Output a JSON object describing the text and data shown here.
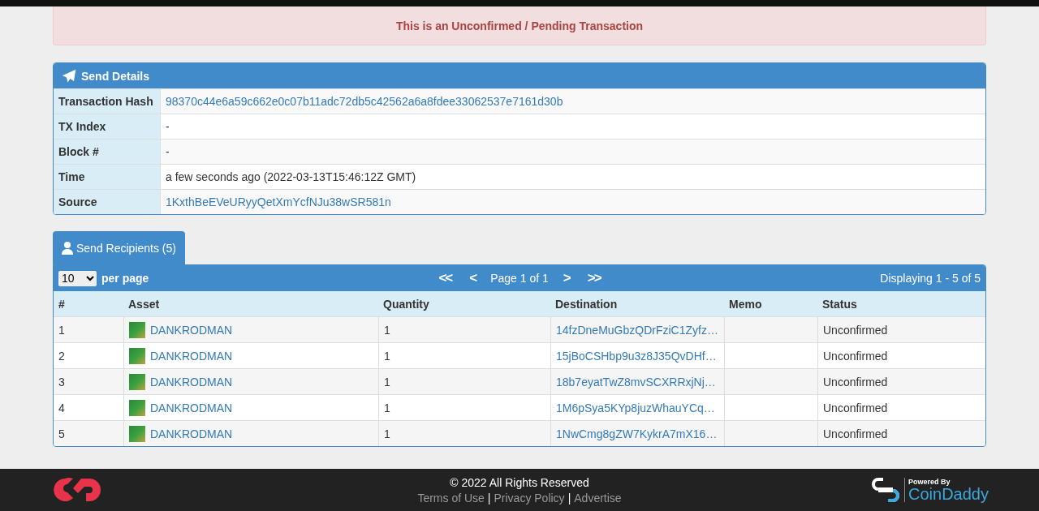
{
  "alert": {
    "text": "This is an Unconfirmed / Pending Transaction"
  },
  "send_details": {
    "title": "Send Details",
    "rows": [
      {
        "label": "Transaction Hash",
        "value": "98370c44e6a59c662e0c07b11adc72db5c42562a6a8fdee33062537e7161d30b",
        "kind": "link"
      },
      {
        "label": "TX Index",
        "value": "-",
        "kind": "text"
      },
      {
        "label": "Block #",
        "value": "-",
        "kind": "text"
      },
      {
        "label": "Time",
        "value": "a few seconds ago (2022-03-13T15:46:12Z GMT)",
        "kind": "text"
      },
      {
        "label": "Source",
        "value": "1KxthBeEVeURyyQetXmYcfNJu38wSR581n",
        "kind": "link"
      }
    ]
  },
  "tabs": [
    {
      "label": "Send Recipients (5)",
      "selected": true
    }
  ],
  "pager": {
    "page_size": "10",
    "per_page": "per page",
    "first": "<<",
    "prev": "<",
    "page": "Page 1 of 1",
    "next": ">",
    "last": ">>",
    "displaying": "Displaying 1 - 5 of 5"
  },
  "table": {
    "columns": [
      "#",
      "Asset",
      "Quantity",
      "Destination",
      "Memo",
      "Status"
    ],
    "rows": [
      {
        "index": "1",
        "asset": "DANKRODMAN",
        "quantity": "1",
        "destination": "14fzDneMuGbzQDrFziC1Zyfz…",
        "status": "Unconfirmed"
      },
      {
        "index": "2",
        "asset": "DANKRODMAN",
        "quantity": "1",
        "destination": "15jBoCSHbp9u3z8J35QvDHf…",
        "status": "Unconfirmed"
      },
      {
        "index": "3",
        "asset": "DANKRODMAN",
        "quantity": "1",
        "destination": "18b7eyatTwZ8mvSCXRRxjNj…",
        "status": "Unconfirmed"
      },
      {
        "index": "4",
        "asset": "DANKRODMAN",
        "quantity": "1",
        "destination": "1M6pSya5KYp8juzWhauYCq…",
        "status": "Unconfirmed"
      },
      {
        "index": "5",
        "asset": "DANKRODMAN",
        "quantity": "1",
        "destination": "1NwCmg8gZW7KykrA7mX16…",
        "status": "Unconfirmed"
      }
    ]
  },
  "footer": {
    "copyright": "© 2022 All Rights Reserved",
    "links": [
      "Terms of Use",
      "Privacy Policy",
      "Advertise"
    ],
    "separator": "|",
    "powered_by": "Powered By",
    "brand": "CoinDaddy"
  }
}
